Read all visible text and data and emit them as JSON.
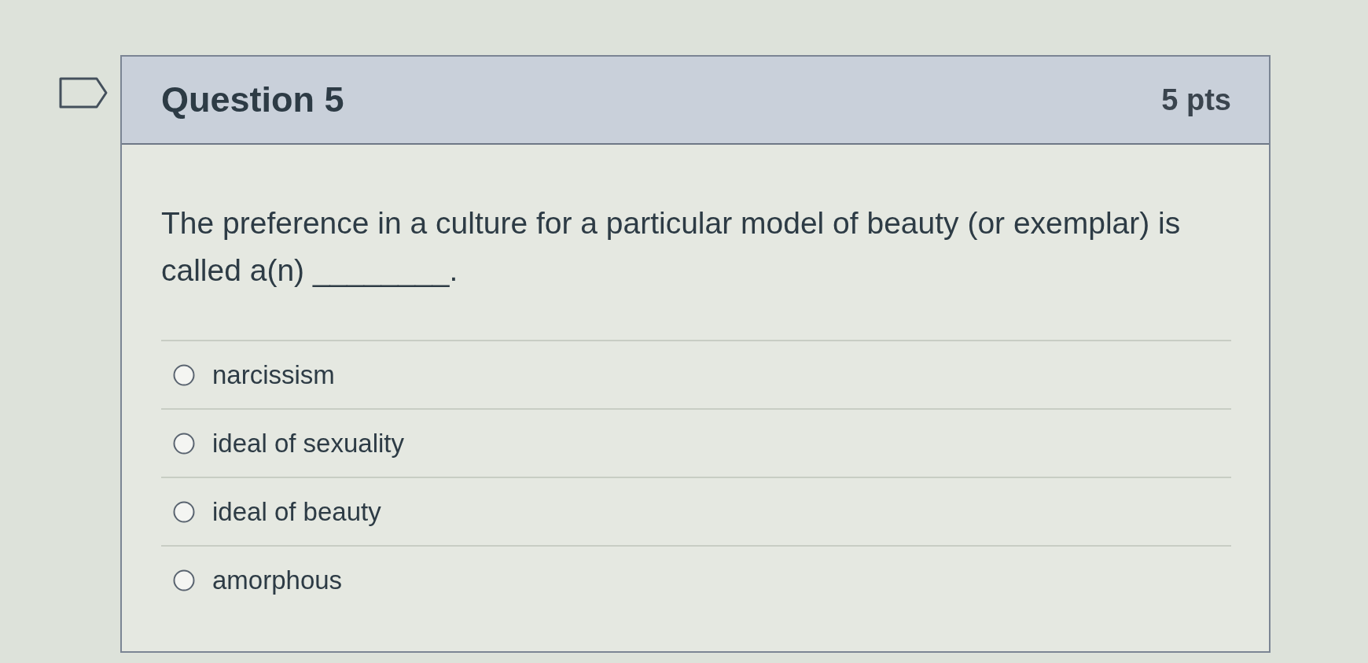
{
  "question": {
    "flagged": false,
    "title": "Question 5",
    "points": "5 pts",
    "text": "The preference in a culture for a particular model of beauty (or exemplar) is called a(n) ________.",
    "options": [
      {
        "label": "narcissism",
        "selected": false
      },
      {
        "label": "ideal of sexuality",
        "selected": false
      },
      {
        "label": "ideal of beauty",
        "selected": false
      },
      {
        "label": "amorphous",
        "selected": false
      }
    ]
  }
}
